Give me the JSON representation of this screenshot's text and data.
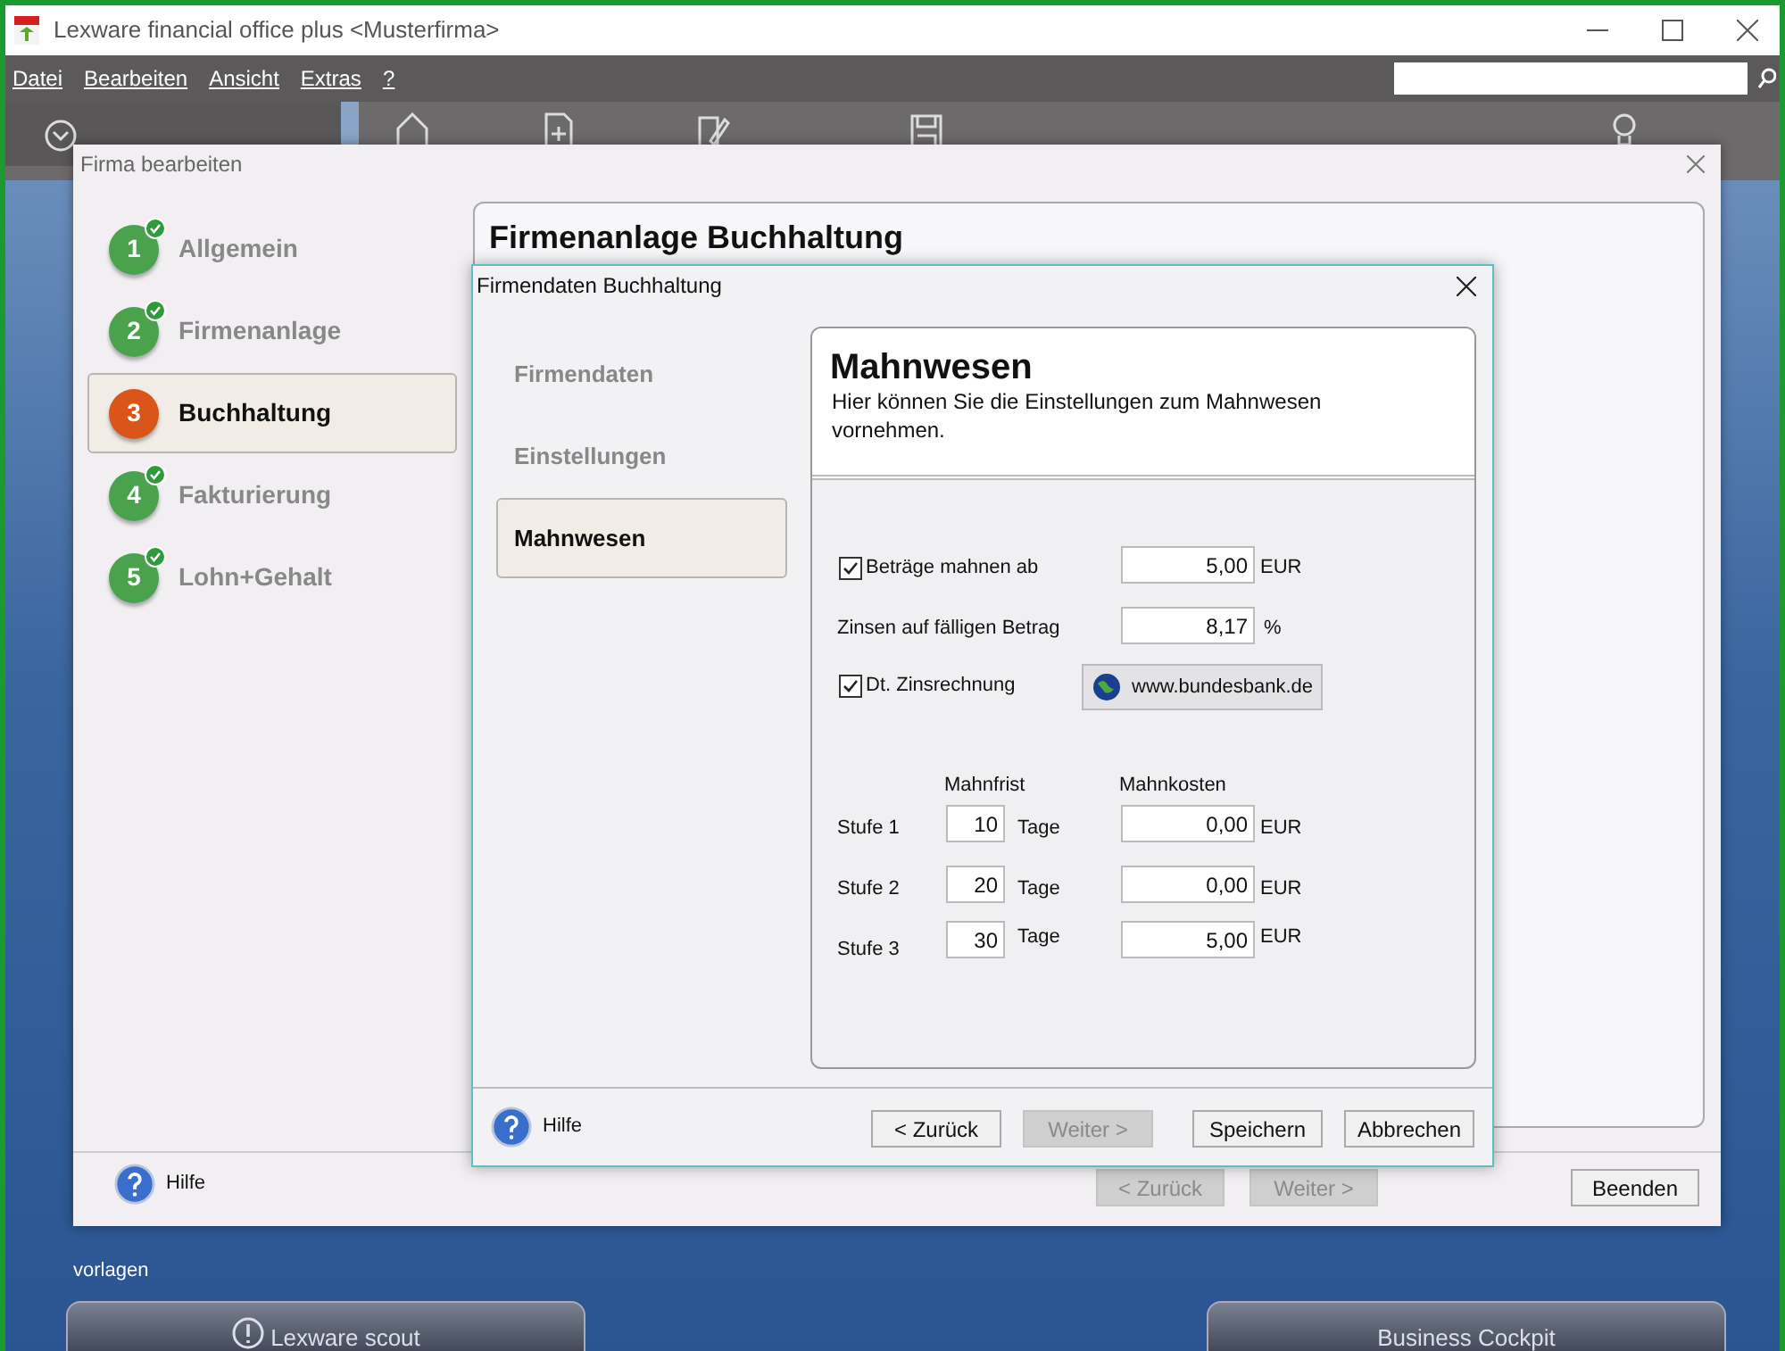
{
  "window": {
    "title": "Lexware financial office plus <Musterfirma>"
  },
  "menu": [
    "Datei",
    "Bearbeiten",
    "Ansicht",
    "Extras",
    "?"
  ],
  "toolbar": {
    "items": [
      {
        "kind": "home"
      },
      {
        "kind": "new"
      },
      {
        "kind": "edit"
      },
      {
        "kind": "save"
      },
      {
        "kind": "support"
      }
    ]
  },
  "wizard": {
    "title": "Firma bearbeiten",
    "steps": [
      {
        "number": "1",
        "label": "Allgemein",
        "done": true,
        "selected": false
      },
      {
        "number": "2",
        "label": "Firmenanlage",
        "done": true,
        "selected": false
      },
      {
        "number": "3",
        "label": "Buchhaltung",
        "done": false,
        "selected": true
      },
      {
        "number": "4",
        "label": "Fakturierung",
        "done": true,
        "selected": false
      },
      {
        "number": "5",
        "label": "Lohn+Gehalt",
        "done": true,
        "selected": false
      }
    ],
    "panel_title": "Firmenanlage Buchhaltung",
    "help": "Hilfe",
    "buttons": [
      {
        "label": "< Zurück",
        "disabled": true
      },
      {
        "label": "Weiter >",
        "disabled": true
      },
      {
        "label": "Beenden",
        "disabled": false
      }
    ]
  },
  "dialog": {
    "title": "Firmendaten Buchhaltung",
    "nav": [
      {
        "label": "Firmendaten",
        "selected": false
      },
      {
        "label": "Einstellungen",
        "selected": false
      },
      {
        "label": "Mahnwesen",
        "selected": true
      }
    ],
    "heading": "Mahnwesen",
    "description": "Hier können Sie die Einstellungen zum Mahnwesen vornehmen.",
    "reminder_threshold": {
      "label": "Beträge mahnen ab",
      "checked": true,
      "value": "5,00",
      "unit": "EUR"
    },
    "interest": {
      "label": "Zinsen auf fälligen Betrag",
      "value": "8,17",
      "unit": "%"
    },
    "german_interest": {
      "label": "Dt. Zinsrechnung",
      "checked": true,
      "link": "www.bundesbank.de"
    },
    "columns": [
      "Mahnfrist",
      "Mahnkosten"
    ],
    "levels": [
      {
        "label": "Stufe 1",
        "days": "10",
        "days_unit": "Tage",
        "cost": "0,00",
        "unit": "EUR"
      },
      {
        "label": "Stufe 2",
        "days": "20",
        "days_unit": "Tage",
        "cost": "0,00",
        "unit": "EUR"
      },
      {
        "label": "Stufe 3",
        "days": "30",
        "days_unit": "Tage",
        "cost": "5,00",
        "unit": "EUR"
      }
    ],
    "help": "Hilfe",
    "buttons": [
      {
        "label": "< Zurück",
        "disabled": false
      },
      {
        "label": "Weiter >",
        "disabled": true
      },
      {
        "label": "Speichern",
        "disabled": false
      },
      {
        "label": "Abbrechen",
        "disabled": false
      }
    ]
  },
  "desktop": {
    "label": "vorlagen",
    "tiles": [
      {
        "kind": "alert",
        "label": "Lexware scout"
      },
      {
        "kind": "plain",
        "label": "Business Cockpit"
      }
    ]
  }
}
